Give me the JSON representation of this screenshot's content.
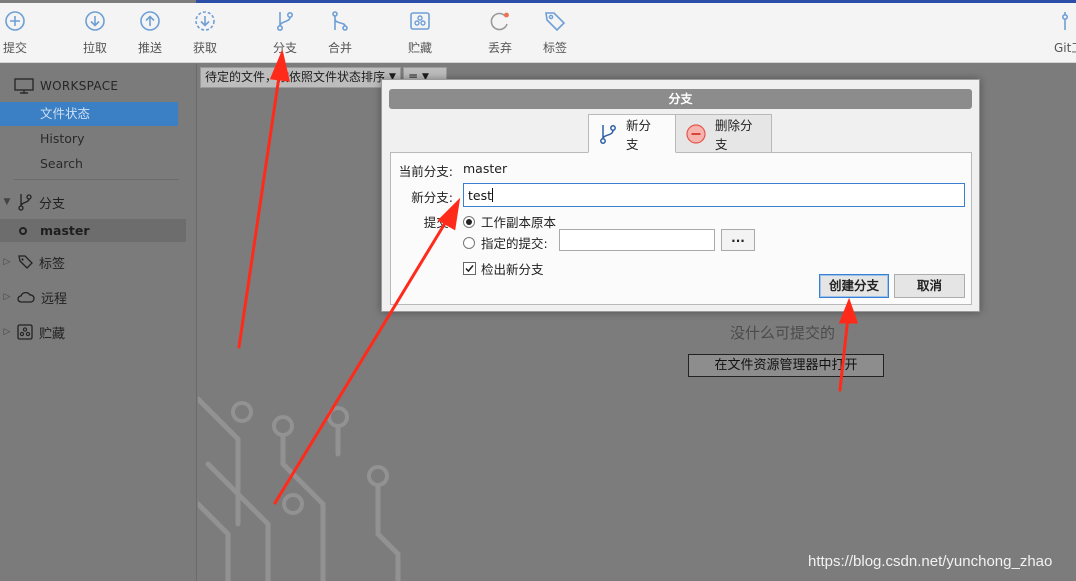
{
  "toolbar": {
    "items": [
      {
        "label": "提交",
        "icon": "plus-circle-icon"
      },
      {
        "label": "拉取",
        "icon": "arrow-down-circle-icon"
      },
      {
        "label": "推送",
        "icon": "arrow-up-circle-icon"
      },
      {
        "label": "获取",
        "icon": "dashed-arrow-down-circle-icon"
      },
      {
        "label": "分支",
        "icon": "branch-icon"
      },
      {
        "label": "合并",
        "icon": "merge-icon"
      },
      {
        "label": "贮藏",
        "icon": "stash-icon"
      },
      {
        "label": "丢弃",
        "icon": "discard-icon"
      },
      {
        "label": "标签",
        "icon": "tag-icon"
      },
      {
        "label": "Git工",
        "icon": "git-flow-icon"
      }
    ]
  },
  "sidebar": {
    "workspace_title": "WORKSPACE",
    "nav": [
      {
        "label": "文件状态",
        "selected": true
      },
      {
        "label": "History",
        "selected": false
      },
      {
        "label": "Search",
        "selected": false
      }
    ],
    "groups": {
      "branches": "分支",
      "tags": "标签",
      "remotes": "远程",
      "stashes": "贮藏"
    },
    "current_branch": "master"
  },
  "main": {
    "sort_select": "待定的文件，按依照文件状态排序",
    "view_select": "≡",
    "empty_text": "没什么可提交的",
    "open_explorer_button": "在文件资源管理器中打开"
  },
  "dialog": {
    "title": "分支",
    "tabs": [
      {
        "label": "新分支",
        "active": true
      },
      {
        "label": "删除分支",
        "active": false
      }
    ],
    "current_branch_label": "当前分支:",
    "current_branch_value": "master",
    "new_branch_label": "新分支:",
    "new_branch_value": "test",
    "commit_label": "提交:",
    "radio_working_copy": "工作副本原本",
    "radio_specific_commit": "指定的提交:",
    "specific_commit_value": "",
    "browse_button": "...",
    "checkout_checkbox": "检出新分支",
    "checkout_checked": true,
    "create_button": "创建分支",
    "cancel_button": "取消"
  },
  "watermark": "https://blog.csdn.net/yunchong_zhao",
  "colors": {
    "accent": "#3b7fc4",
    "top_strip": "#2b4fa8",
    "annotation_arrow": "#ff2a1a",
    "toolbar_icon": "#5b8fcc"
  }
}
